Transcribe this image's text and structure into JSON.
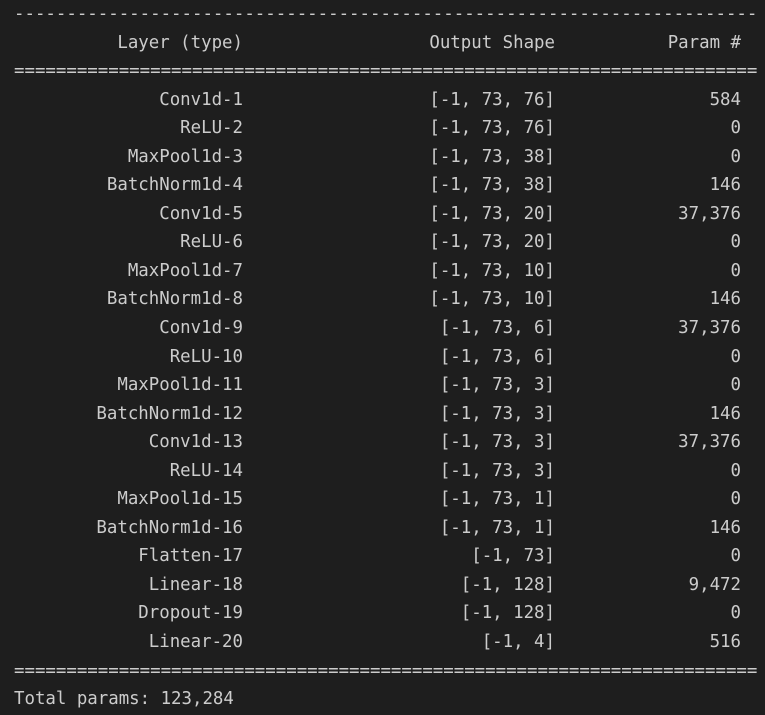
{
  "separators": {
    "dash": "-----------------------------------------------------------------------",
    "equals": "======================================================================="
  },
  "header": {
    "layer": "Layer (type)",
    "shape": "Output Shape",
    "param": "Param #"
  },
  "rows": [
    {
      "layer": "Conv1d-1",
      "shape": "[-1, 73, 76]",
      "param": "584"
    },
    {
      "layer": "ReLU-2",
      "shape": "[-1, 73, 76]",
      "param": "0"
    },
    {
      "layer": "MaxPool1d-3",
      "shape": "[-1, 73, 38]",
      "param": "0"
    },
    {
      "layer": "BatchNorm1d-4",
      "shape": "[-1, 73, 38]",
      "param": "146"
    },
    {
      "layer": "Conv1d-5",
      "shape": "[-1, 73, 20]",
      "param": "37,376"
    },
    {
      "layer": "ReLU-6",
      "shape": "[-1, 73, 20]",
      "param": "0"
    },
    {
      "layer": "MaxPool1d-7",
      "shape": "[-1, 73, 10]",
      "param": "0"
    },
    {
      "layer": "BatchNorm1d-8",
      "shape": "[-1, 73, 10]",
      "param": "146"
    },
    {
      "layer": "Conv1d-9",
      "shape": "[-1, 73, 6]",
      "param": "37,376"
    },
    {
      "layer": "ReLU-10",
      "shape": "[-1, 73, 6]",
      "param": "0"
    },
    {
      "layer": "MaxPool1d-11",
      "shape": "[-1, 73, 3]",
      "param": "0"
    },
    {
      "layer": "BatchNorm1d-12",
      "shape": "[-1, 73, 3]",
      "param": "146"
    },
    {
      "layer": "Conv1d-13",
      "shape": "[-1, 73, 3]",
      "param": "37,376"
    },
    {
      "layer": "ReLU-14",
      "shape": "[-1, 73, 3]",
      "param": "0"
    },
    {
      "layer": "MaxPool1d-15",
      "shape": "[-1, 73, 1]",
      "param": "0"
    },
    {
      "layer": "BatchNorm1d-16",
      "shape": "[-1, 73, 1]",
      "param": "146"
    },
    {
      "layer": "Flatten-17",
      "shape": "[-1, 73]",
      "param": "0"
    },
    {
      "layer": "Linear-18",
      "shape": "[-1, 128]",
      "param": "9,472"
    },
    {
      "layer": "Dropout-19",
      "shape": "[-1, 128]",
      "param": "0"
    },
    {
      "layer": "Linear-20",
      "shape": "[-1, 4]",
      "param": "516"
    }
  ],
  "footer": {
    "total_params": "Total params: 123,284"
  }
}
